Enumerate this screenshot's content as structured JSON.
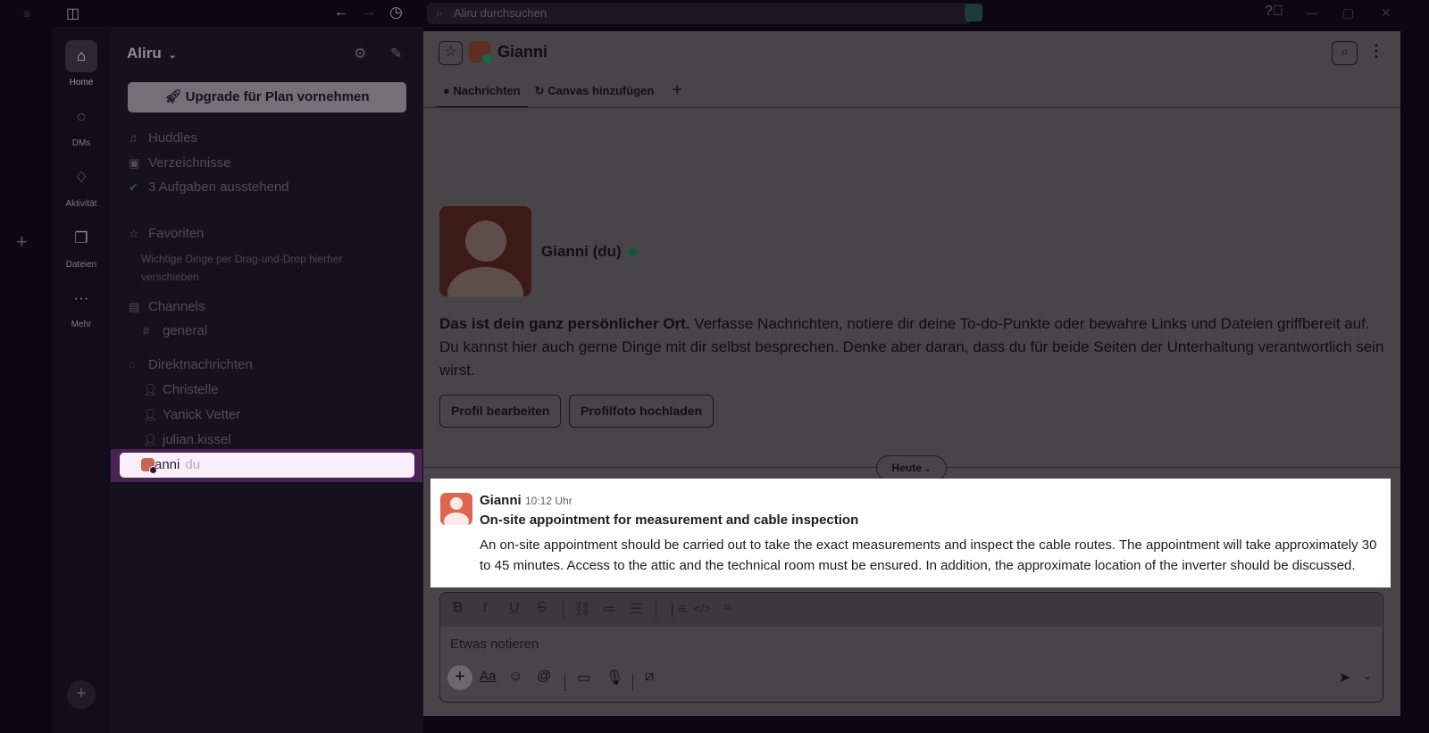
{
  "topbar": {
    "search_placeholder": "Aliru durchsuchen"
  },
  "rail": {
    "items": [
      {
        "label": "Home",
        "icon": "home-icon"
      },
      {
        "label": "DMs",
        "icon": "dms-icon"
      },
      {
        "label": "Aktivität",
        "icon": "bell-icon"
      },
      {
        "label": "Dateien",
        "icon": "files-icon"
      },
      {
        "label": "Mehr",
        "icon": "more-icon"
      }
    ]
  },
  "sidebar": {
    "workspace": "Aliru",
    "upgrade_label": "Upgrade für Plan vornehmen",
    "huddles": "Huddles",
    "verzeichnisse": "Verzeichnisse",
    "tasks": "3 Aufgaben ausstehend",
    "favorites_header": "Favoriten",
    "favorites_hint": "Wichtige Dinge per Drag-und-Drop hierher verschieben",
    "channels_header": "Channels",
    "channels": [
      "general"
    ],
    "dm_header": "Direktnachrichten",
    "dms": [
      "Christelle",
      "Yanick Vetter",
      "julian.kissel"
    ],
    "selected_dm": "Gianni",
    "selected_suffix": "du"
  },
  "main": {
    "title": "Gianni",
    "tabs": [
      "Nachrichten",
      "Canvas hinzufügen"
    ],
    "profile_name": "Gianni (du)",
    "intro_bold": "Das ist dein ganz persönlicher Ort.",
    "intro_rest": " Verfasse Nachrichten, notiere dir deine To-do-Punkte oder bewahre Links und Dateien griffbereit auf. Du kannst hier auch gerne Dinge mit dir selbst besprechen. Denke aber daran, dass du für beide Seiten der Unterhaltung verantwortlich sein wirst.",
    "edit_profile": "Profil bearbeiten",
    "upload_photo": "Profilfoto hochladen",
    "day_divider": "Heute"
  },
  "message": {
    "author": "Gianni",
    "time": "10:12 Uhr",
    "subject": "On-site appointment for measurement and cable inspection",
    "body": "An on-site appointment should be carried out to take the exact measurements and inspect the cable routes. The appointment will take approximately 30 to 45 minutes. Access to the attic and the technical room must be ensured. In addition, the approximate location of the inverter should be discussed."
  },
  "composer": {
    "placeholder": "Etwas notieren",
    "format_label": "Aa"
  }
}
